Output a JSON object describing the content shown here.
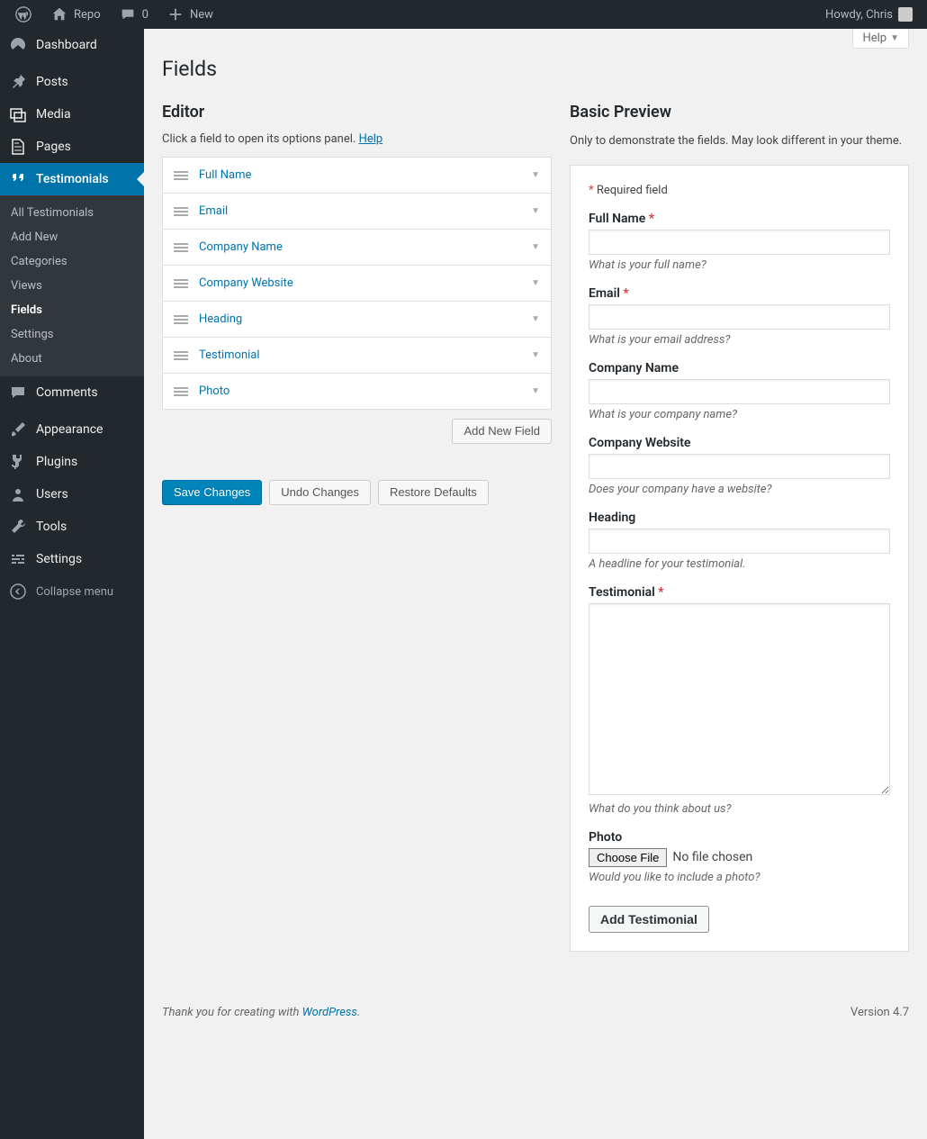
{
  "adminbar": {
    "site_name": "Repo",
    "comments_count": "0",
    "new_label": "New",
    "howdy": "Howdy, Chris"
  },
  "sidebar": {
    "items": [
      {
        "label": "Dashboard",
        "icon": "dashboard"
      },
      {
        "label": "Posts",
        "icon": "pin"
      },
      {
        "label": "Media",
        "icon": "media"
      },
      {
        "label": "Pages",
        "icon": "page"
      },
      {
        "label": "Testimonials",
        "icon": "quote",
        "current": true
      },
      {
        "label": "Comments",
        "icon": "comment"
      },
      {
        "label": "Appearance",
        "icon": "brush"
      },
      {
        "label": "Plugins",
        "icon": "plug"
      },
      {
        "label": "Users",
        "icon": "user"
      },
      {
        "label": "Tools",
        "icon": "wrench"
      },
      {
        "label": "Settings",
        "icon": "sliders"
      }
    ],
    "submenu": [
      "All Testimonials",
      "Add New",
      "Categories",
      "Views",
      "Fields",
      "Settings",
      "About"
    ],
    "submenu_current_index": 4,
    "collapse_label": "Collapse menu"
  },
  "screen": {
    "help_label": "Help",
    "page_title": "Fields"
  },
  "editor": {
    "title": "Editor",
    "help_prefix": "Click a field to open its options panel. ",
    "help_link": "Help",
    "fields": [
      "Full Name",
      "Email",
      "Company Name",
      "Company Website",
      "Heading",
      "Testimonial",
      "Photo"
    ],
    "add_label": "Add New Field",
    "save_label": "Save Changes",
    "undo_label": "Undo Changes",
    "restore_label": "Restore Defaults"
  },
  "preview": {
    "title": "Basic Preview",
    "desc": "Only to demonstrate the fields. May look different in your theme.",
    "required_note": "Required field",
    "fields": [
      {
        "label": "Full Name",
        "required": true,
        "hint": "What is your full name?",
        "type": "text"
      },
      {
        "label": "Email",
        "required": true,
        "hint": "What is your email address?",
        "type": "text"
      },
      {
        "label": "Company Name",
        "required": false,
        "hint": "What is your company name?",
        "type": "text"
      },
      {
        "label": "Company Website",
        "required": false,
        "hint": "Does your company have a website?",
        "type": "text"
      },
      {
        "label": "Heading",
        "required": false,
        "hint": "A headline for your testimonial.",
        "type": "text"
      },
      {
        "label": "Testimonial",
        "required": true,
        "hint": "What do you think about us?",
        "type": "textarea"
      },
      {
        "label": "Photo",
        "required": false,
        "hint": "Would you like to include a photo?",
        "type": "file"
      }
    ],
    "file_button": "Choose File",
    "file_status": "No file chosen",
    "submit_label": "Add Testimonial"
  },
  "footer": {
    "thanks_prefix": "Thank you for creating with ",
    "wp_link": "WordPress",
    "version": "Version 4.7"
  }
}
